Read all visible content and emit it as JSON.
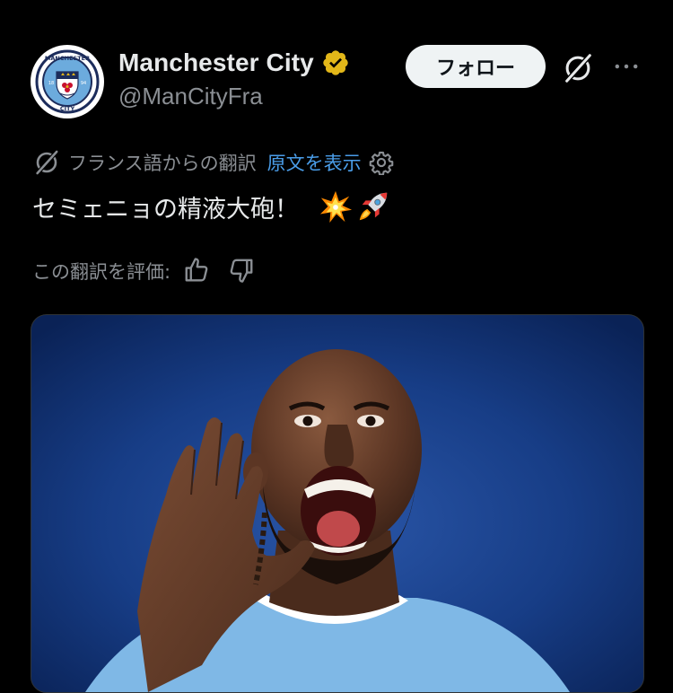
{
  "account": {
    "display_name": "Manchester City",
    "handle": "@ManCityFra",
    "verified_badge_color": "#e2b719",
    "avatar_icon": "manchester-city-crest-icon",
    "crest_text_top": "MANCHESTER",
    "crest_text_bottom": "CITY",
    "crest_year_left": "18",
    "crest_year_right": "94"
  },
  "actions": {
    "follow_label": "フォロー",
    "grok_icon": "grok-icon",
    "more_icon": "more-horizontal-icon"
  },
  "translation": {
    "icon": "grok-icon",
    "label": "フランス語からの翻訳",
    "show_original_label": "原文を表示",
    "settings_icon": "gear-icon"
  },
  "tweet": {
    "text": "セミェニョの精液大砲！",
    "emojis": [
      "collision-emoji",
      "rocket-emoji"
    ]
  },
  "rating": {
    "label": "この翻訳を評価:",
    "thumbs_up_icon": "thumbs-up-icon",
    "thumbs_down_icon": "thumbs-down-icon"
  },
  "media": {
    "type": "photo",
    "description_icon": "player-photo",
    "background_color": "#0e2c63",
    "kit_color": "#7fb8e6"
  },
  "colors": {
    "background": "#000000",
    "text_primary": "#e7e9ea",
    "text_secondary": "#8b8f94",
    "link": "#4a9de8",
    "follow_bg": "#eff3f4"
  }
}
